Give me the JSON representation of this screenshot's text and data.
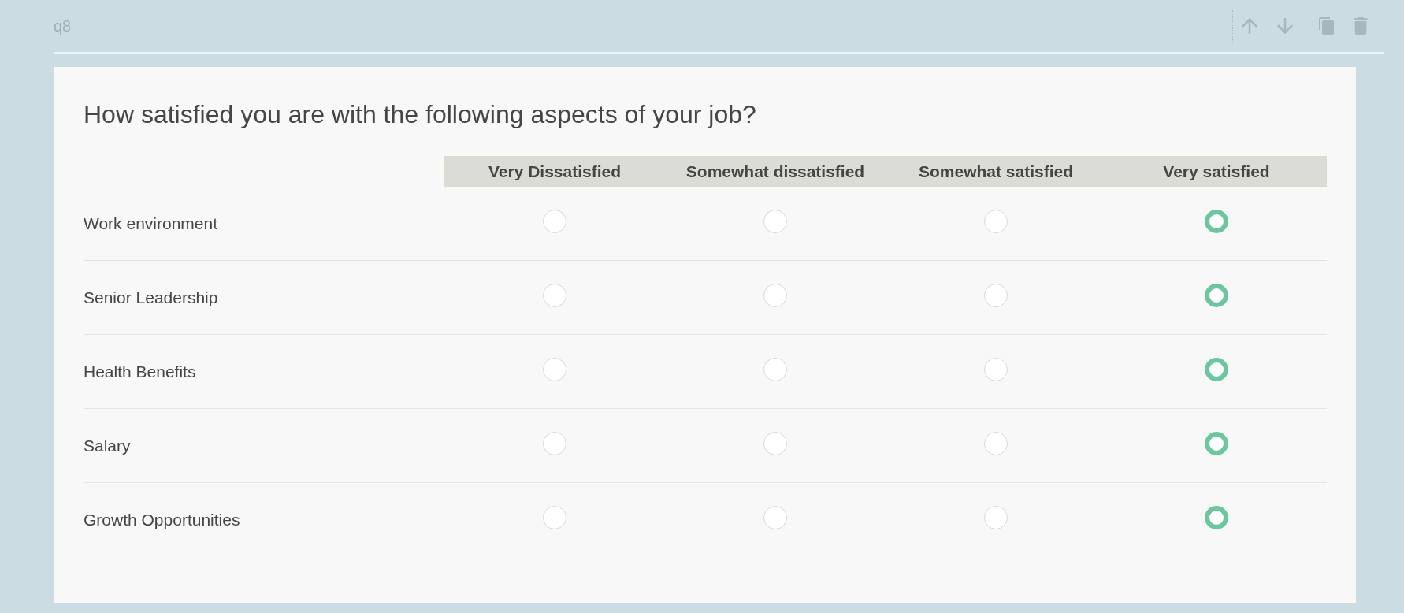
{
  "question": {
    "id": "q8",
    "title": "How satisfied you are with the following aspects of your job?"
  },
  "matrix": {
    "columns": [
      "Very Dissatisfied",
      "Somewhat dissatisfied",
      "Somewhat satisfied",
      "Very satisfied"
    ],
    "rows": [
      {
        "label": "Work environment",
        "options": [
          {
            "selected": false
          },
          {
            "selected": false
          },
          {
            "selected": false
          },
          {
            "selected": true
          }
        ]
      },
      {
        "label": "Senior Leadership",
        "options": [
          {
            "selected": false
          },
          {
            "selected": false
          },
          {
            "selected": false
          },
          {
            "selected": true
          }
        ]
      },
      {
        "label": "Health Benefits",
        "options": [
          {
            "selected": false
          },
          {
            "selected": false
          },
          {
            "selected": false
          },
          {
            "selected": true
          }
        ]
      },
      {
        "label": "Salary",
        "options": [
          {
            "selected": false
          },
          {
            "selected": false
          },
          {
            "selected": false
          },
          {
            "selected": true
          }
        ]
      },
      {
        "label": "Growth Opportunities",
        "options": [
          {
            "selected": false
          },
          {
            "selected": false
          },
          {
            "selected": false
          },
          {
            "selected": true
          }
        ]
      }
    ]
  }
}
